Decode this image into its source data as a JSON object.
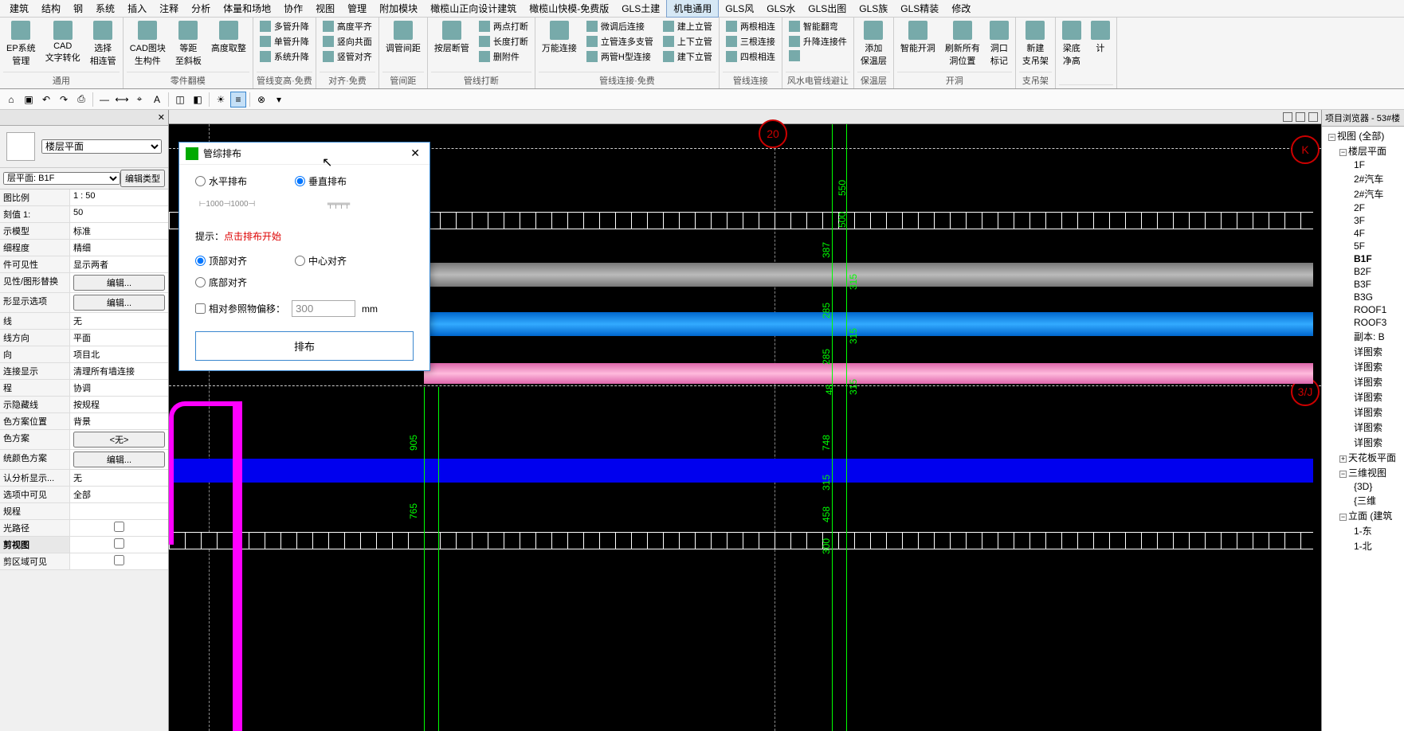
{
  "menu": {
    "items": [
      "建筑",
      "结构",
      "钢",
      "系统",
      "插入",
      "注释",
      "分析",
      "体量和场地",
      "协作",
      "视图",
      "管理",
      "附加模块",
      "橄榄山正向设计建筑",
      "橄榄山快模-免费版",
      "GLS土建",
      "机电通用",
      "GLS风",
      "GLS水",
      "GLS出图",
      "GLS族",
      "GLS精装",
      "修改"
    ],
    "active_index": 15
  },
  "ribbon": {
    "groups": [
      {
        "label": "通用",
        "large": [
          {
            "t": "EP系统\n管理"
          },
          {
            "t": "CAD\n文字转化"
          },
          {
            "t": "选择\n相连管"
          }
        ]
      },
      {
        "label": "零件翻模",
        "large": [
          {
            "t": "CAD图块\n生构件"
          },
          {
            "t": "等距\n至斜板"
          },
          {
            "t": "高度取整"
          }
        ]
      },
      {
        "label": "管线变高·免费",
        "stack": [
          [
            "多管升降",
            "单管升降",
            "系统升降"
          ]
        ],
        "large": []
      },
      {
        "label": "对齐·免费",
        "stack": [
          [
            "高度平齐",
            "竖向共面",
            "竖管对齐"
          ]
        ]
      },
      {
        "label": "管间距",
        "large": [
          {
            "t": "调管间距"
          }
        ]
      },
      {
        "label": "管线打断",
        "stack": [
          [
            "两点打断",
            "长度打断",
            "删附件"
          ]
        ],
        "large": [
          {
            "t": "按层断管"
          }
        ]
      },
      {
        "label": "管线连接·免费",
        "stack": [
          [
            "微调后连接",
            "立管连多支管",
            "两管H型连接"
          ],
          [
            "建上立管",
            "上下立管",
            "建下立管"
          ]
        ],
        "large": [
          {
            "t": "万能连接"
          }
        ]
      },
      {
        "label": "管线连接",
        "stack": [
          [
            "两根相连",
            "三根连接",
            "四根相连"
          ]
        ]
      },
      {
        "label": "风水电管线避让",
        "stack": [
          [
            "智能翻弯",
            "升降连接件",
            ""
          ]
        ]
      },
      {
        "label": "保温层",
        "large": [
          {
            "t": "添加\n保温层"
          }
        ]
      },
      {
        "label": "开洞",
        "large": [
          {
            "t": "智能开洞"
          },
          {
            "t": "刷新所有\n洞位置"
          },
          {
            "t": "洞口\n标记"
          }
        ]
      },
      {
        "label": "支吊架",
        "large": [
          {
            "t": "新建\n支吊架"
          }
        ]
      },
      {
        "label": "",
        "large": [
          {
            "t": "梁底\n净高"
          },
          {
            "t": "计"
          }
        ]
      }
    ]
  },
  "props": {
    "header": "",
    "view_type": "楼层平面",
    "view_name": "层平面: B1F",
    "edit_type": "编辑类型",
    "rows": [
      {
        "k": "图比例",
        "v": "1 : 50",
        "editable": true
      },
      {
        "k": "刻值 1:",
        "v": "50"
      },
      {
        "k": "示模型",
        "v": "标准"
      },
      {
        "k": "细程度",
        "v": "精细"
      },
      {
        "k": "件可见性",
        "v": "显示两者"
      },
      {
        "k": "见性/图形替换",
        "v": "编辑...",
        "btn": true
      },
      {
        "k": "形显示选项",
        "v": "编辑...",
        "btn": true
      },
      {
        "k": "线",
        "v": "无"
      },
      {
        "k": "线方向",
        "v": "平面"
      },
      {
        "k": "向",
        "v": "项目北"
      },
      {
        "k": "连接显示",
        "v": "清理所有墙连接"
      },
      {
        "k": "程",
        "v": "协调"
      },
      {
        "k": "示隐藏线",
        "v": "按规程"
      },
      {
        "k": "色方案位置",
        "v": "背景"
      },
      {
        "k": "色方案",
        "v": "<无>",
        "btn": true
      },
      {
        "k": "统颜色方案",
        "v": "编辑...",
        "btn": true
      },
      {
        "k": "认分析显示...",
        "v": "无"
      },
      {
        "k": "选项中可见",
        "v": "全部"
      },
      {
        "k": "规程",
        "v": ""
      },
      {
        "k": "光路径",
        "v": "",
        "chk": true
      },
      {
        "k": "剪视图",
        "v": "",
        "chk": true,
        "sec": "图"
      },
      {
        "k": "剪区域可见",
        "v": "",
        "chk": true
      }
    ]
  },
  "browser": {
    "title": "项目浏览器 - 53#楼",
    "root": "视图 (全部)",
    "floor_plans_label": "楼层平面",
    "floors": [
      "1F",
      "2#汽车",
      "2#汽车",
      "2F",
      "3F",
      "4F",
      "5F",
      "B1F",
      "B2F",
      "B3F",
      "B3G",
      "ROOF1",
      "ROOF3",
      "副本: B",
      "详图索",
      "详图索",
      "详图索",
      "详图索",
      "详图索",
      "详图索",
      "详图索"
    ],
    "active_floor": "B1F",
    "ceiling": "天花板平面",
    "three_d": "三维视图",
    "three_d_items": [
      "{3D}",
      "{三维"
    ],
    "elev": "立面 (建筑",
    "elev_items": [
      "1-东",
      "1-北"
    ]
  },
  "dialog": {
    "title": "管综排布",
    "layout_h": "水平排布",
    "layout_v": "垂直排布",
    "hint_label": "提示：",
    "hint_text": "点击排布开始",
    "align_top": "顶部对齐",
    "align_center": "中心对齐",
    "align_bottom": "底部对齐",
    "offset_chk": "相对参照物偏移：",
    "offset_val": "300",
    "offset_unit": "mm",
    "go": "排布"
  },
  "canvas": {
    "grid1": "20",
    "grid2": "K",
    "grid3": "3/J",
    "dims": [
      "550",
      "500",
      "387",
      "315",
      "285",
      "315",
      "285",
      "48",
      "315",
      "748",
      "315",
      "458",
      "300",
      "905",
      "765"
    ]
  }
}
